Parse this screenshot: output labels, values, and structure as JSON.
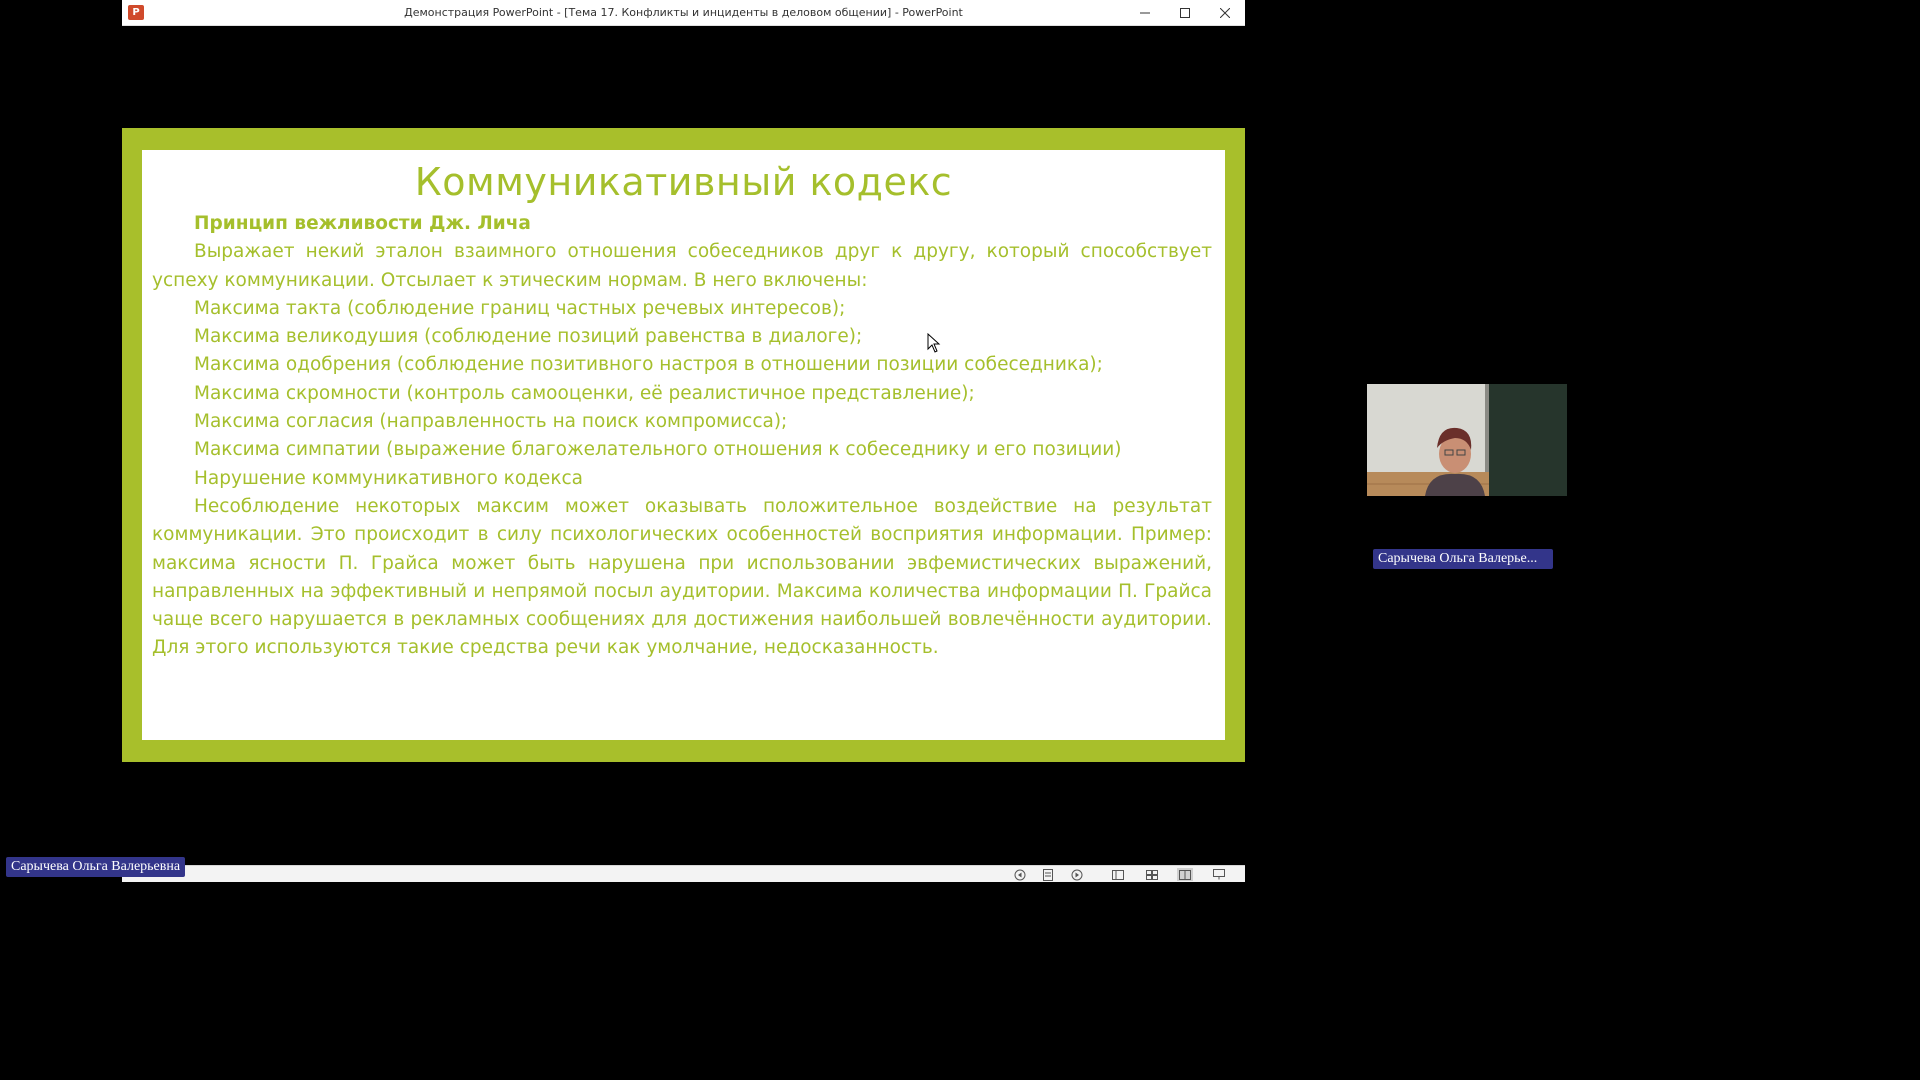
{
  "window": {
    "title": "Демонстрация PowerPoint - [Тема  17. Конфликты и инциденты в деловом общении] - PowerPoint",
    "app_icon": "powerpoint-icon",
    "controls": [
      "minimize-icon",
      "maximize-icon",
      "close-icon"
    ]
  },
  "slide": {
    "title": "Коммуникативный кодекс",
    "heading": "Принцип вежливости Дж. Лича",
    "intro": "Выражает некий эталон взаимного отношения собеседников друг к другу, который способствует успеху коммуникации. Отсылает к этическим нормам. В него включены:",
    "maxims": [
      "Максима такта (соблюдение границ частных речевых интересов);",
      "Максима великодушия (соблюдение позиций равенства в диалоге);",
      "Максима одобрения (соблюдение позитивного настроя в отношении позиции собеседника);",
      "Максима скромности (контроль самооценки, её реалистичное представление);",
      "Максима согласия (направленность на поиск компромисса);",
      "Максима симпатии (выражение благожелательного отношения к собеседнику и его позиции)"
    ],
    "subheading": "Нарушение коммуникативного кодекса",
    "closing": "Несоблюдение некоторых максим может оказывать положительное воздействие на результат коммуникации. Это происходит в силу психологических особенностей восприятия информации. Пример: максима ясности П. Грайса может быть нарушена при использовании эвфемистических выражений, направленных на эффективный и непрямой посыл аудитории. Максима количества информации П. Грайса чаще всего нарушается в рекламных сообщениях для достижения наибольшей вовлечённости аудитории. Для этого используются такие средства речи как умолчание, недосказанность.",
    "accent_color": "#a5bf2c",
    "frame_color": "#a8bf2b"
  },
  "statusbar": {
    "icons": [
      "previous-slide-icon",
      "notes-icon",
      "next-slide-icon",
      "normal-view-icon",
      "slide-sorter-icon",
      "reading-view-icon",
      "slideshow-icon"
    ]
  },
  "participants": {
    "video_name": "Сарычева Ольга Валерье...",
    "presenter_name": "Сарычева Ольга Валерьевна",
    "badge_color": "#33358a"
  }
}
